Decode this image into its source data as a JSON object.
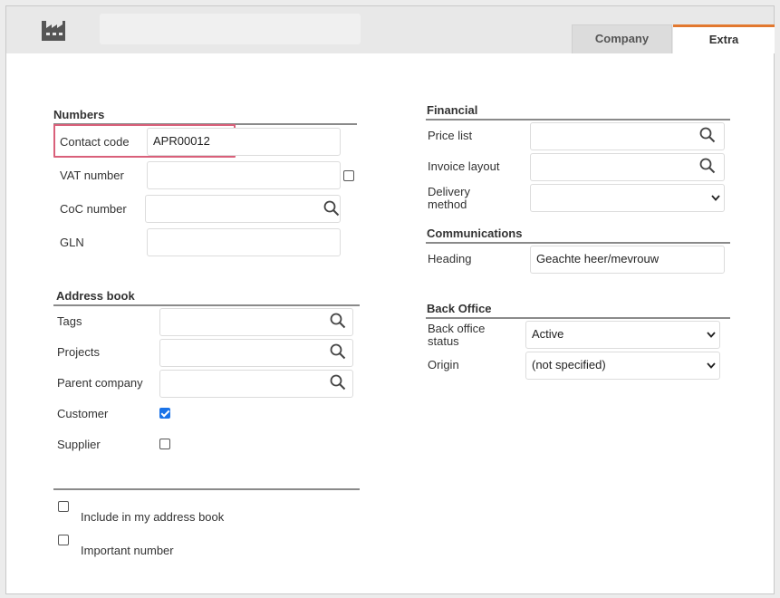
{
  "header": {
    "tabs": [
      {
        "label": "Company",
        "active": false
      },
      {
        "label": "Extra",
        "active": true
      }
    ],
    "icon": "factory-icon"
  },
  "numbers": {
    "title": "Numbers",
    "contact_code_label": "Contact code",
    "contact_code_value": "APR00012",
    "vat_label": "VAT number",
    "vat_value": "",
    "coc_label": "CoC number",
    "coc_value": "",
    "gln_label": "GLN",
    "gln_value": ""
  },
  "address_book": {
    "title": "Address book",
    "tags_label": "Tags",
    "projects_label": "Projects",
    "parent_company_label": "Parent company",
    "customer_label": "Customer",
    "customer_checked": true,
    "supplier_label": "Supplier",
    "supplier_checked": false
  },
  "footer_options": {
    "include_label": "Include in my address book",
    "include_checked": false,
    "important_label": "Important number",
    "important_checked": false
  },
  "financial": {
    "title": "Financial",
    "price_list_label": "Price list",
    "invoice_layout_label": "Invoice layout",
    "delivery_method_label_1": "Delivery",
    "delivery_method_label_2": "method",
    "delivery_method_value": ""
  },
  "communications": {
    "title": "Communications",
    "heading_label": "Heading",
    "heading_value": "Geachte heer/mevrouw"
  },
  "back_office": {
    "title": "Back Office",
    "status_label_1": "Back office",
    "status_label_2": "status",
    "status_value": "Active",
    "origin_label": "Origin",
    "origin_value": "(not specified)"
  },
  "colors": {
    "accent": "#e2782f",
    "highlight": "#d9607a",
    "checkbox_checked": "#1a73e8"
  }
}
